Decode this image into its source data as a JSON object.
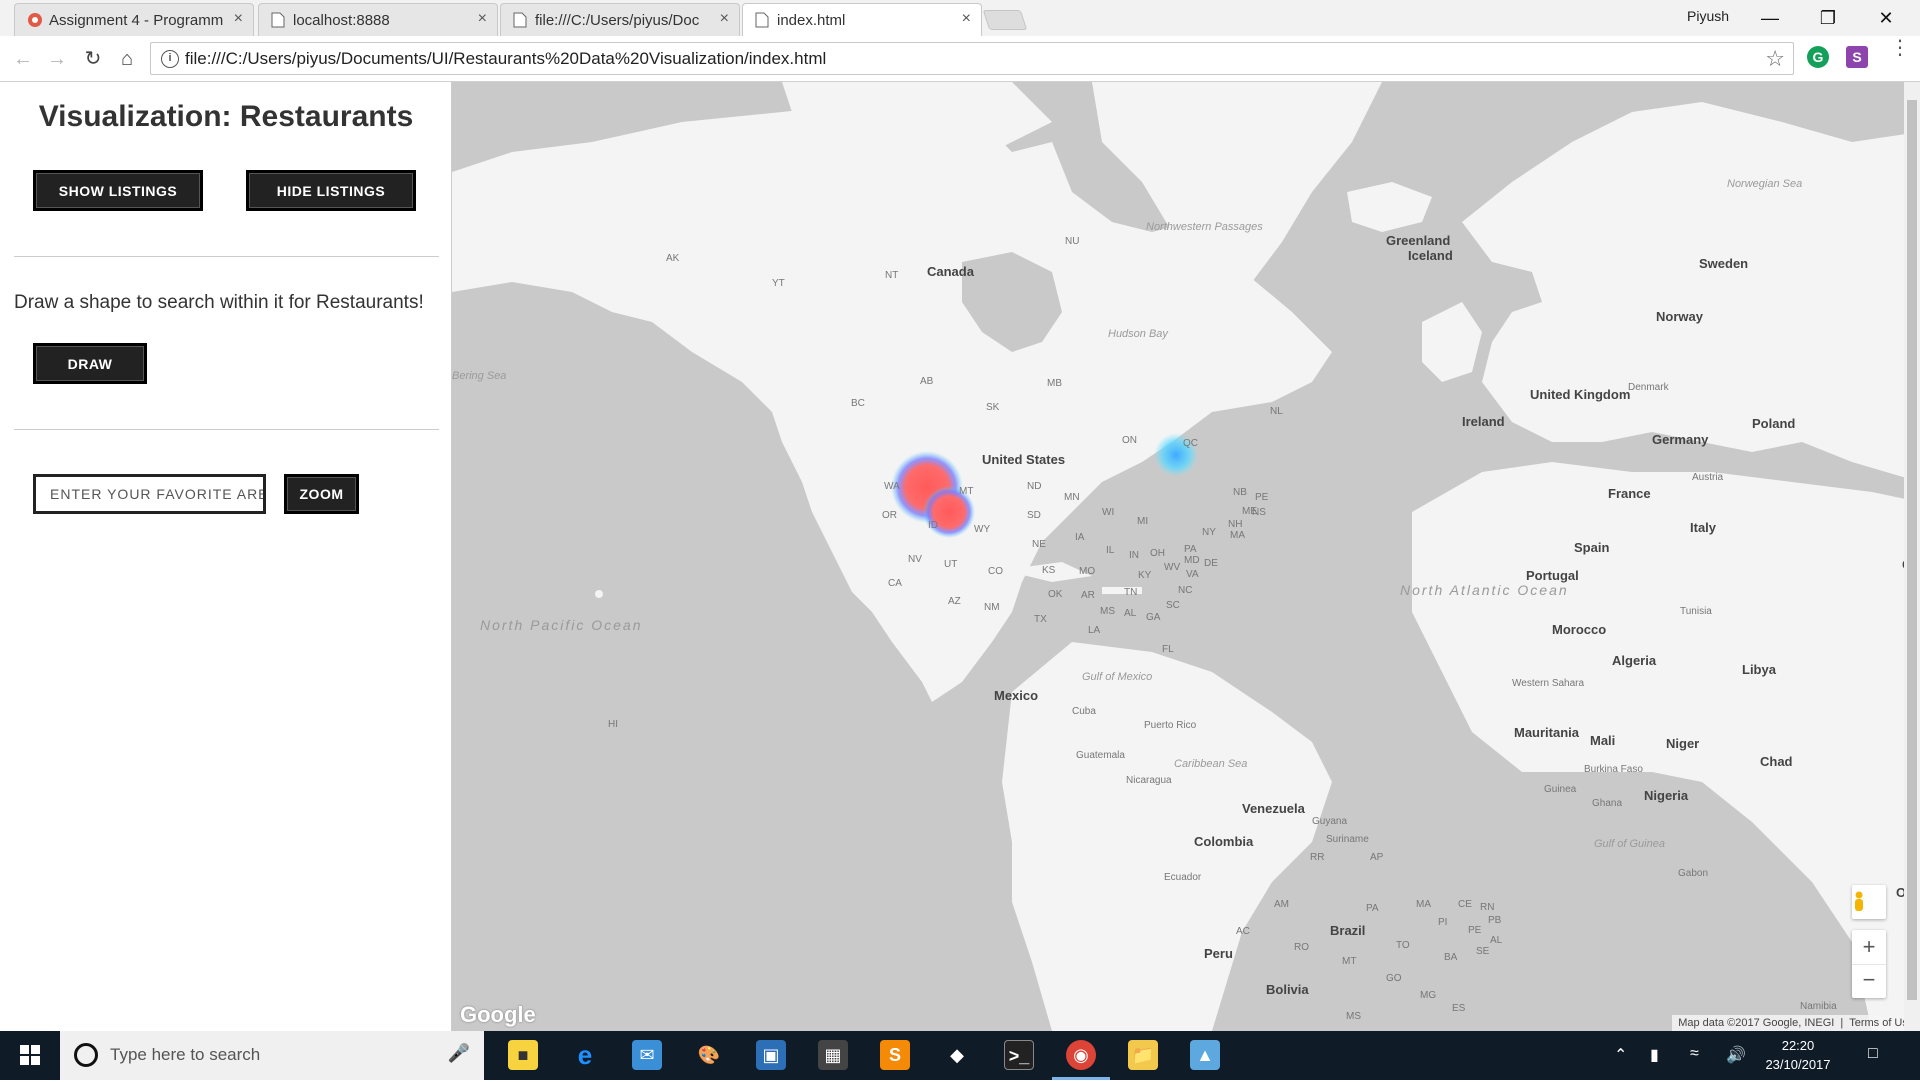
{
  "browser": {
    "tabs": [
      {
        "title": "Assignment 4 - Programm",
        "icon": "app-icon",
        "active": false
      },
      {
        "title": "localhost:8888",
        "icon": "page-icon",
        "active": false
      },
      {
        "title": "file:///C:/Users/piyus/Doc",
        "icon": "page-icon",
        "active": false
      },
      {
        "title": "index.html",
        "icon": "page-icon",
        "active": true
      }
    ],
    "tab_close": "×",
    "profile_name": "Piyush",
    "url": "file:///C:/Users/piyus/Documents/UI/Restaurants%20Data%20Visualization/index.html",
    "extensions": [
      {
        "letter": "G",
        "color": "#15a05a"
      },
      {
        "letter": "S",
        "color": "#8d44ad"
      }
    ]
  },
  "panel": {
    "title": "Visualization: Restaurants",
    "show_listings": "SHOW LISTINGS",
    "hide_listings": "HIDE LISTINGS",
    "draw_instruction": "Draw a shape to search within it for Restaurants!",
    "draw_button": "DRAW",
    "zoom_placeholder": "ENTER YOUR FAVORITE AREA",
    "zoom_button": "ZOOM"
  },
  "map": {
    "labels": {
      "canada": "Canada",
      "us": "United States",
      "mexico": "Mexico",
      "greenland": "Greenland",
      "iceland": "Iceland",
      "ireland": "Ireland",
      "uk": "United Kingdom",
      "norway": "Norway",
      "sweden": "Sweden",
      "denmark": "Denmark",
      "germany": "Germany",
      "poland": "Poland",
      "france": "France",
      "austria": "Austria",
      "italy": "Italy",
      "spain": "Spain",
      "portugal": "Portugal",
      "tunisia": "Tunisia",
      "morocco": "Morocco",
      "algeria": "Algeria",
      "libya": "Libya",
      "western_sahara": "Western Sahara",
      "mauritania": "Mauritania",
      "mali": "Mali",
      "niger": "Niger",
      "chad": "Chad",
      "burkina": "Burkina Faso",
      "guinea": "Guinea",
      "ghana": "Ghana",
      "nigeria": "Nigeria",
      "gabon": "Gabon",
      "namibia": "Namibia",
      "cuba": "Cuba",
      "puerto_rico": "Puerto Rico",
      "guatemala": "Guatemala",
      "nicaragua": "Nicaragua",
      "venezuela": "Venezuela",
      "guyana": "Guyana",
      "suriname": "Suriname",
      "colombia": "Colombia",
      "ecuador": "Ecuador",
      "peru": "Peru",
      "brazil": "Brazil",
      "bolivia": "Bolivia",
      "hudson_bay": "Hudson Bay",
      "nw_passages": "Northwestern Passages",
      "bering_sea": "Bering Sea",
      "norwegian_sea": "Norwegian Sea",
      "north_pacific": "North Pacific Ocean",
      "north_atlantic": "North Atlantic Ocean",
      "gulf_mexico": "Gulf of Mexico",
      "caribbean": "Caribbean Sea",
      "gulf_guinea": "Gulf of Guinea"
    },
    "regions": {
      "AK": "AK",
      "YT": "YT",
      "NT": "NT",
      "NU": "NU",
      "BC": "BC",
      "AB": "AB",
      "SK": "SK",
      "MB": "MB",
      "ON": "ON",
      "QC": "QC",
      "NL": "NL",
      "NB": "NB",
      "PE": "PE",
      "NS": "NS",
      "WA": "WA",
      "OR": "OR",
      "ID": "ID",
      "MT": "MT",
      "WY": "WY",
      "NV": "NV",
      "CA": "CA",
      "UT": "UT",
      "AZ": "AZ",
      "CO": "CO",
      "NM": "NM",
      "ND": "ND",
      "SD": "SD",
      "NE": "NE",
      "KS": "KS",
      "OK": "OK",
      "TX": "TX",
      "MN": "MN",
      "IA": "IA",
      "MO": "MO",
      "AR": "AR",
      "LA": "LA",
      "WI": "WI",
      "IL": "IL",
      "MI": "MI",
      "IN": "IN",
      "OH": "OH",
      "KY": "KY",
      "TN": "TN",
      "MS": "MS",
      "AL": "AL",
      "GA": "GA",
      "FL": "FL",
      "SC": "SC",
      "NC": "NC",
      "VA": "VA",
      "WV": "WV",
      "PA": "PA",
      "MD": "MD",
      "DE": "DE",
      "NY": "NY",
      "MA": "MA",
      "NH": "NH",
      "ME": "ME",
      "HI": "HI",
      "AM": "AM",
      "PA2": "PA",
      "MA2": "MA",
      "CE": "CE",
      "RN": "RN",
      "PB": "PB",
      "PI": "PI",
      "PE2": "PE",
      "AL2": "AL",
      "SE": "SE",
      "TO": "TO",
      "BA": "BA",
      "AC": "AC",
      "RO": "RO",
      "MT2": "MT",
      "GO": "GO",
      "MG": "MG",
      "MS2": "MS",
      "ES": "ES",
      "RR": "RR",
      "AP": "AP",
      "GR": "Gr",
      "OR2": "OR"
    },
    "google": "Google",
    "attribution": "Map data ©2017 Google, INEGI",
    "terms": "Terms of Use",
    "zoom_in": "+",
    "zoom_out": "−"
  },
  "taskbar": {
    "search_placeholder": "Type here to search",
    "time": "22:20",
    "date": "23/10/2017"
  }
}
